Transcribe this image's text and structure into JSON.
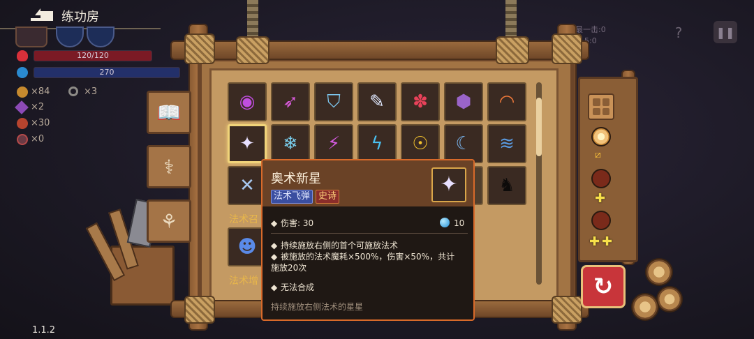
{
  "header": {
    "room_title": "练功房",
    "back_icon": "back-arrow-icon"
  },
  "hud": {
    "hp_text": "120/120",
    "hp_max": 120,
    "hp_value": 120,
    "mp_text": "270",
    "items": [
      {
        "icon": "coin-icon",
        "text": "×84",
        "color": "#c68a2e"
      },
      {
        "icon": "key-icon",
        "text": "×3",
        "color": "#8c8a86"
      },
      {
        "icon": "gem-icon",
        "text": "×2",
        "color": "#8c4ab6"
      },
      {
        "icon": "bomb-icon",
        "text": "×30",
        "color": "#b6442e"
      },
      {
        "icon": "skull-icon",
        "text": "×0",
        "color": "#b64a4a"
      }
    ],
    "colors": {
      "hp": "#7b1a25",
      "mp": "#23306a"
    }
  },
  "tabs": [
    {
      "icon": "book-icon",
      "glyph": "📖"
    },
    {
      "icon": "staff-icon",
      "glyph": "⚕"
    },
    {
      "icon": "scroll-icon",
      "glyph": "⚘"
    }
  ],
  "spell_grid": {
    "row1": [
      {
        "icon": "purple-orb-icon",
        "glyph": "◉",
        "color": "#c04ee0"
      },
      {
        "icon": "arrow-spell-icon",
        "glyph": "➶",
        "color": "#d65ad8"
      },
      {
        "icon": "snake-spell-icon",
        "glyph": "⛉",
        "color": "#7ec8f0"
      },
      {
        "icon": "crystal-bolt-icon",
        "glyph": "✎",
        "color": "#dfe8ff"
      },
      {
        "icon": "red-slime-icon",
        "glyph": "✽",
        "color": "#e8425a"
      },
      {
        "icon": "purple-rock-icon",
        "glyph": "⬢",
        "color": "#9a64c8"
      },
      {
        "icon": "rainbow-icon",
        "glyph": "◠",
        "color": "#f27a3a"
      }
    ],
    "row2": [
      {
        "icon": "arcane-star-icon",
        "glyph": "✦",
        "color": "#e8e0ff",
        "selected": true
      },
      {
        "icon": "ice-shard-icon",
        "glyph": "❄",
        "color": "#7ad0f0"
      },
      {
        "icon": "purple-lightning-icon",
        "glyph": "⚡",
        "color": "#d45ae0"
      },
      {
        "icon": "blue-lightning-icon",
        "glyph": "ϟ",
        "color": "#4ac0f0"
      },
      {
        "icon": "gold-coin-spell-icon",
        "glyph": "☉",
        "color": "#f2c22e"
      },
      {
        "icon": "blue-slash-icon",
        "glyph": "☾",
        "color": "#7ab6f0"
      },
      {
        "icon": "blue-wave-icon",
        "glyph": "≋",
        "color": "#5a9ae0"
      }
    ],
    "row3": [
      {
        "icon": "crossed-swords-icon",
        "glyph": "✕",
        "color": "#a8c8f0"
      },
      {
        "icon": "locked-slot-icon",
        "glyph": "",
        "color": "#3a2a22"
      },
      {
        "icon": "locked-slot-icon",
        "glyph": "",
        "color": "#3a2a22"
      },
      {
        "icon": "locked-slot-icon",
        "glyph": "",
        "color": "#3a2a22"
      },
      {
        "icon": "locked-slot-icon",
        "glyph": "",
        "color": "#3a2a22"
      },
      {
        "icon": "locked-slot-icon",
        "glyph": "",
        "color": "#3a2a22"
      },
      {
        "icon": "shadow-beast-icon",
        "glyph": "♞",
        "color": "#0d0b0a"
      }
    ],
    "section_summon_label": "法术召",
    "summon_slot": {
      "icon": "blue-ghost-icon",
      "glyph": "☻",
      "color": "#5a8ae8"
    },
    "section_bottom_label": "法术增"
  },
  "tooltip": {
    "name": "奥术新星",
    "icon": "arcane-star-icon",
    "type_tag": "法术飞弹",
    "rarity_tag": "史诗",
    "damage_label": "伤害: 30",
    "mana_cost": "10",
    "desc_line1": "持续施放右侧的首个可施放法术",
    "desc_line2": "被施放的法术魔耗×500%，伤害×50%，共计",
    "desc_line3": "施放20次",
    "note": "无法合成",
    "flavor": "持续施放右侧法术的星星",
    "colors": {
      "border": "#d86a2a",
      "type_tag": "#3a4ea0",
      "rarity_tag": "#8a2d2a"
    }
  },
  "side_panel": {
    "grid_icon": "inventory-grid-icon",
    "slots": [
      {
        "icon": "orb-slot-icon",
        "color": "#f2c27a"
      },
      {
        "icon": "empty-slot-icon",
        "color": "#7a2a1a"
      },
      {
        "icon": "empty-slot-icon",
        "color": "#7a2a1a"
      }
    ],
    "plus_glyph": "✚",
    "link_glyph": "⧄"
  },
  "reset_button_glyph": "↻",
  "top_right": {
    "stat1": "最一击:0",
    "stat2": "：5:0",
    "help_glyph": "?",
    "pause_glyph": "❚❚"
  },
  "version": "1.1.2"
}
